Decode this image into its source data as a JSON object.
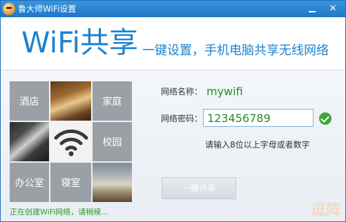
{
  "window": {
    "title": "鲁大师WiFi设置",
    "minimize_glyph": "",
    "close_glyph": "✕"
  },
  "header": {
    "brand": "WiFi共享",
    "slogan": "一键设置，手机电脑共享无线网络"
  },
  "tiles": {
    "hotel": "酒店",
    "home": "家庭",
    "campus": "校园",
    "office": "办公室",
    "bedroom": "寝室"
  },
  "form": {
    "ssid_label": "网络名称：",
    "ssid_value": "mywifi",
    "password_label": "网络密码：",
    "password_value": "123456789",
    "hint": "请输入8位以上字母或者数字",
    "share_button": "一键共享"
  },
  "status": "正在创建WiFi网络，请稍候...",
  "watermark": "逗阵",
  "colors": {
    "accent_blue": "#1d83cf",
    "success_green": "#2b9a2b",
    "tile_gray": "#9aa0a6"
  },
  "icons": {
    "app": "ludashi-face-icon",
    "wifi": "wifi-signal-icon",
    "valid": "check-circle-icon"
  }
}
